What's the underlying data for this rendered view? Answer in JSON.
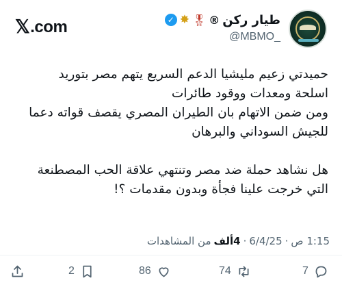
{
  "header": {
    "brand": ".com",
    "display_name": "طيار ركن",
    "handle": "@MBMO_",
    "badges": [
      "registered-icon",
      "gold-medal-icon",
      "ribbon-medal-icon",
      "verified-badge-icon"
    ]
  },
  "tweet": {
    "text": "حميدتي زعيم مليشيا  الدعم السريع يتهم مصر بتوريد\nاسلحة ومعدات ووقود طائرات\nومن ضمن الاتهام بان الطيران المصري يقصف قواته دعما\nللجيش السوداني والبرهان\n\nهل نشاهد حملة ضد مصر وتنتهي علاقة الحب المصطنعة\nالتي خرجت علينا فجأة وبدون مقدمات ؟!",
    "time": "1:15 ص",
    "date": "6/4/25",
    "separator": "·",
    "views_count": "4ألف",
    "views_label": "من المشاهدات"
  },
  "actions": {
    "replies": "7",
    "retweets": "74",
    "likes": "86",
    "bookmarks": "2"
  },
  "colors": {
    "accent": "#1d9bf0",
    "muted": "#536471",
    "text": "#0f1419"
  }
}
